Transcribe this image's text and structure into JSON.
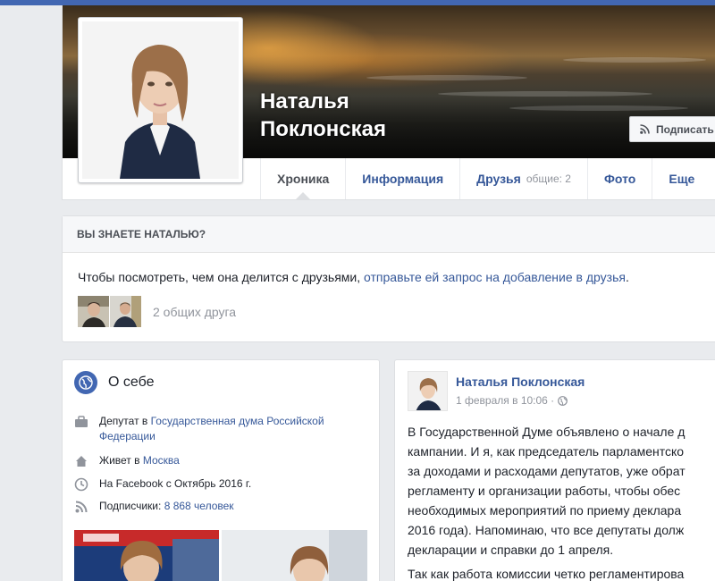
{
  "profile": {
    "name": "Наталья Поклонская",
    "subscribe_label": "Подписать"
  },
  "tabs": [
    {
      "label": "Хроника"
    },
    {
      "label": "Информация"
    },
    {
      "label": "Друзья",
      "sub": "общие: 2"
    },
    {
      "label": "Фото"
    },
    {
      "label": "Еще"
    }
  ],
  "know": {
    "heading": "ВЫ ЗНАЕТЕ НАТАЛЬЮ?",
    "text": "Чтобы посмотреть, чем она делится с друзьями, ",
    "link": "отправьте ей запрос на добавление в друзья",
    "text_end": ".",
    "mutual": "2 общих друга"
  },
  "about": {
    "title": "О себе",
    "rows": [
      {
        "icon": "briefcase-icon",
        "prefix": "Депутат в ",
        "link": "Государственная дума Российской Федерации",
        "suffix": ""
      },
      {
        "icon": "house-icon",
        "prefix": "Живет в ",
        "link": "Москва",
        "suffix": ""
      },
      {
        "icon": "clock-icon",
        "prefix": "На Facebook с Октябрь 2016 г.",
        "link": "",
        "suffix": ""
      },
      {
        "icon": "rss-icon",
        "prefix": "Подписчики: ",
        "link": "8 868 человек",
        "suffix": ""
      }
    ]
  },
  "post": {
    "author": "Наталья Поклонская",
    "date": "1 февраля в 10:06 ·",
    "lines_p1": [
      "В Государственной Думе объявлено о начале д",
      "кампании. И я, как председатель парламентско",
      "за доходами и расходами депутатов, уже обрат",
      "регламенту и организации работы, чтобы обес",
      "необходимых мероприятий по приему деклара",
      "2016 года). Напоминаю, что все депутаты долж",
      "декларации и справки до 1 апреля."
    ],
    "line_p2": "Так как работа комиссии четко регламентирова"
  },
  "colors": {
    "brand": "#4267b2",
    "link": "#365899",
    "background": "#e9ebee"
  }
}
